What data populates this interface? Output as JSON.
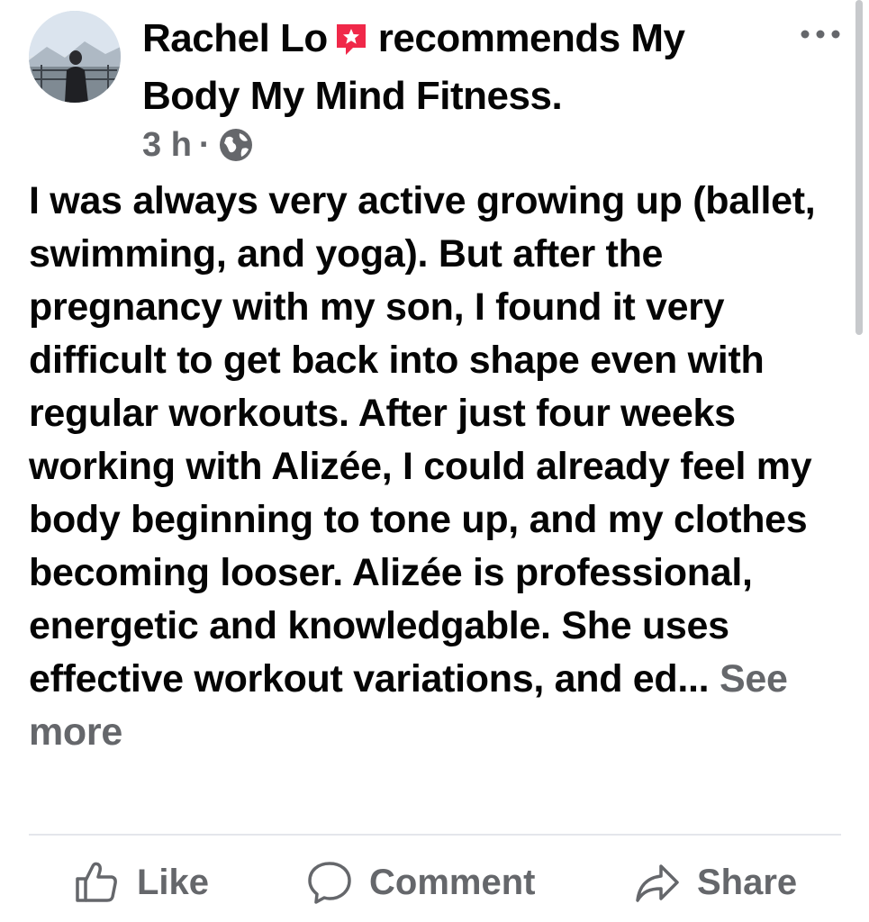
{
  "post": {
    "author": "Rachel Lo",
    "recommends_text": "recommends",
    "page_name": "My Body My Mind Fitness.",
    "time": "3 h",
    "separator": "·",
    "privacy_icon": "globe-icon",
    "recommend_icon": "recommendation-star-icon",
    "body": "I was always very active growing up (ballet, swimming, and yoga). But after the pregnancy with my son, I found it very difficult to get back into shape even with regular workouts. After just four weeks working with Alizée, I could already feel my body beginning to tone up, and my clothes becoming looser. Alizée is professional, energetic and knowledgable. She uses effective workout variations, and ed...",
    "see_more": "See more"
  },
  "actions": {
    "like": "Like",
    "comment": "Comment",
    "share": "Share"
  },
  "colors": {
    "text": "#050505",
    "secondary": "#65676b",
    "recommend": "#f02849",
    "divider": "#e4e6eb"
  }
}
